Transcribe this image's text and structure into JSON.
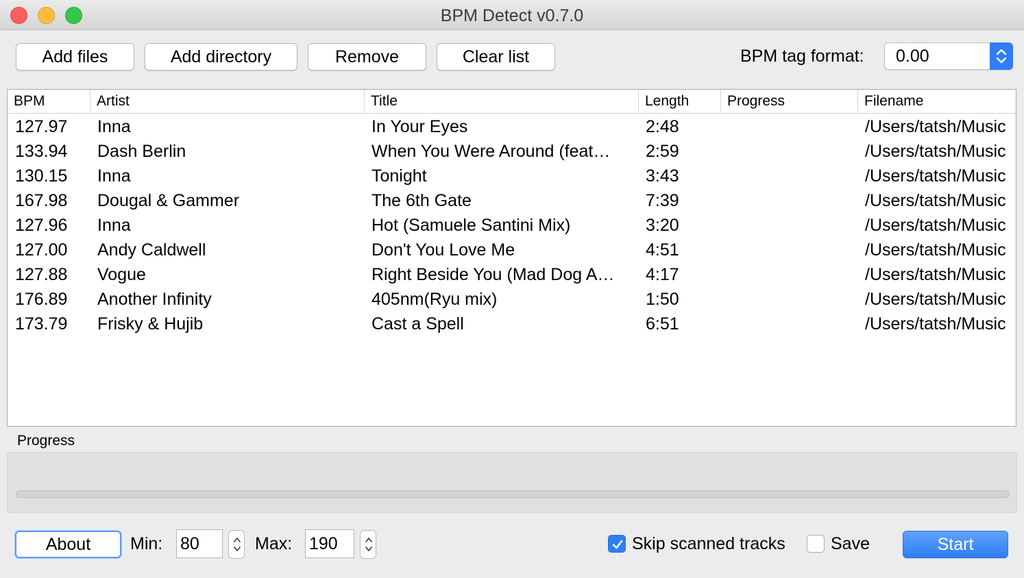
{
  "window": {
    "title": "BPM Detect v0.7.0"
  },
  "toolbar": {
    "add_files": "Add files",
    "add_directory": "Add directory",
    "remove": "Remove",
    "clear_list": "Clear list",
    "bpm_tag_format_label": "BPM tag format:",
    "bpm_tag_format_value": "0.00"
  },
  "table": {
    "columns": [
      "BPM",
      "Artist",
      "Title",
      "Length",
      "Progress",
      "Filename"
    ],
    "rows": [
      {
        "bpm": "127.97",
        "artist": "Inna",
        "title": "In Your Eyes",
        "length": "2:48",
        "progress": "",
        "filename": "/Users/tatsh/Music"
      },
      {
        "bpm": "133.94",
        "artist": "Dash Berlin",
        "title": "When You Were Around (feat…",
        "length": "2:59",
        "progress": "",
        "filename": "/Users/tatsh/Music"
      },
      {
        "bpm": "130.15",
        "artist": "Inna",
        "title": "Tonight",
        "length": "3:43",
        "progress": "",
        "filename": "/Users/tatsh/Music"
      },
      {
        "bpm": "167.98",
        "artist": "Dougal & Gammer",
        "title": "The 6th Gate",
        "length": "7:39",
        "progress": "",
        "filename": "/Users/tatsh/Music"
      },
      {
        "bpm": "127.96",
        "artist": "Inna",
        "title": "Hot (Samuele Santini Mix)",
        "length": "3:20",
        "progress": "",
        "filename": "/Users/tatsh/Music"
      },
      {
        "bpm": "127.00",
        "artist": "Andy Caldwell",
        "title": "Don't You Love Me",
        "length": "4:51",
        "progress": "",
        "filename": "/Users/tatsh/Music"
      },
      {
        "bpm": "127.88",
        "artist": "Vogue",
        "title": "Right Beside You (Mad Dog A…",
        "length": "4:17",
        "progress": "",
        "filename": "/Users/tatsh/Music"
      },
      {
        "bpm": "176.89",
        "artist": "Another Infinity",
        "title": "405nm(Ryu mix)",
        "length": "1:50",
        "progress": "",
        "filename": "/Users/tatsh/Music"
      },
      {
        "bpm": "173.79",
        "artist": "Frisky & Hujib",
        "title": "Cast a Spell",
        "length": "6:51",
        "progress": "",
        "filename": "/Users/tatsh/Music"
      }
    ]
  },
  "progress": {
    "label": "Progress",
    "fraction": 0
  },
  "footer": {
    "about": "About",
    "min_label": "Min:",
    "min_value": "80",
    "max_label": "Max:",
    "max_value": "190",
    "skip_scanned_label": "Skip scanned tracks",
    "skip_scanned_checked": true,
    "save_label": "Save",
    "save_checked": false,
    "start": "Start"
  },
  "colors": {
    "accent": "#2f7ef5",
    "close": "#fc605c",
    "minimize": "#fdbc40",
    "maximize": "#34c84a"
  },
  "icons": [
    "close-icon",
    "minimize-icon",
    "maximize-icon",
    "chevron-updown-icon",
    "checkmark-icon"
  ]
}
